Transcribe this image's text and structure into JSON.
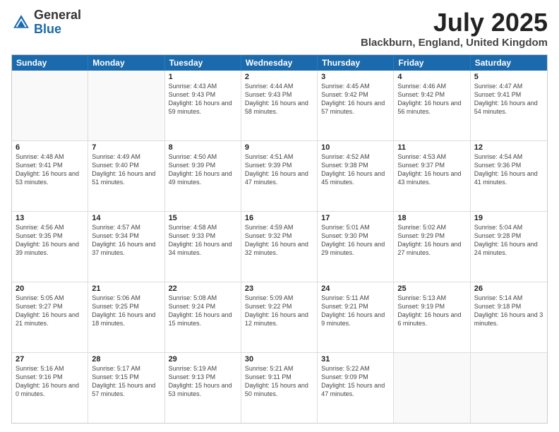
{
  "logo": {
    "general": "General",
    "blue": "Blue"
  },
  "title": {
    "month": "July 2025",
    "location": "Blackburn, England, United Kingdom"
  },
  "days_of_week": [
    "Sunday",
    "Monday",
    "Tuesday",
    "Wednesday",
    "Thursday",
    "Friday",
    "Saturday"
  ],
  "weeks": [
    [
      {
        "day": "",
        "sunrise": "",
        "sunset": "",
        "daylight": ""
      },
      {
        "day": "",
        "sunrise": "",
        "sunset": "",
        "daylight": ""
      },
      {
        "day": "1",
        "sunrise": "Sunrise: 4:43 AM",
        "sunset": "Sunset: 9:43 PM",
        "daylight": "Daylight: 16 hours and 59 minutes."
      },
      {
        "day": "2",
        "sunrise": "Sunrise: 4:44 AM",
        "sunset": "Sunset: 9:43 PM",
        "daylight": "Daylight: 16 hours and 58 minutes."
      },
      {
        "day": "3",
        "sunrise": "Sunrise: 4:45 AM",
        "sunset": "Sunset: 9:42 PM",
        "daylight": "Daylight: 16 hours and 57 minutes."
      },
      {
        "day": "4",
        "sunrise": "Sunrise: 4:46 AM",
        "sunset": "Sunset: 9:42 PM",
        "daylight": "Daylight: 16 hours and 56 minutes."
      },
      {
        "day": "5",
        "sunrise": "Sunrise: 4:47 AM",
        "sunset": "Sunset: 9:41 PM",
        "daylight": "Daylight: 16 hours and 54 minutes."
      }
    ],
    [
      {
        "day": "6",
        "sunrise": "Sunrise: 4:48 AM",
        "sunset": "Sunset: 9:41 PM",
        "daylight": "Daylight: 16 hours and 53 minutes."
      },
      {
        "day": "7",
        "sunrise": "Sunrise: 4:49 AM",
        "sunset": "Sunset: 9:40 PM",
        "daylight": "Daylight: 16 hours and 51 minutes."
      },
      {
        "day": "8",
        "sunrise": "Sunrise: 4:50 AM",
        "sunset": "Sunset: 9:39 PM",
        "daylight": "Daylight: 16 hours and 49 minutes."
      },
      {
        "day": "9",
        "sunrise": "Sunrise: 4:51 AM",
        "sunset": "Sunset: 9:39 PM",
        "daylight": "Daylight: 16 hours and 47 minutes."
      },
      {
        "day": "10",
        "sunrise": "Sunrise: 4:52 AM",
        "sunset": "Sunset: 9:38 PM",
        "daylight": "Daylight: 16 hours and 45 minutes."
      },
      {
        "day": "11",
        "sunrise": "Sunrise: 4:53 AM",
        "sunset": "Sunset: 9:37 PM",
        "daylight": "Daylight: 16 hours and 43 minutes."
      },
      {
        "day": "12",
        "sunrise": "Sunrise: 4:54 AM",
        "sunset": "Sunset: 9:36 PM",
        "daylight": "Daylight: 16 hours and 41 minutes."
      }
    ],
    [
      {
        "day": "13",
        "sunrise": "Sunrise: 4:56 AM",
        "sunset": "Sunset: 9:35 PM",
        "daylight": "Daylight: 16 hours and 39 minutes."
      },
      {
        "day": "14",
        "sunrise": "Sunrise: 4:57 AM",
        "sunset": "Sunset: 9:34 PM",
        "daylight": "Daylight: 16 hours and 37 minutes."
      },
      {
        "day": "15",
        "sunrise": "Sunrise: 4:58 AM",
        "sunset": "Sunset: 9:33 PM",
        "daylight": "Daylight: 16 hours and 34 minutes."
      },
      {
        "day": "16",
        "sunrise": "Sunrise: 4:59 AM",
        "sunset": "Sunset: 9:32 PM",
        "daylight": "Daylight: 16 hours and 32 minutes."
      },
      {
        "day": "17",
        "sunrise": "Sunrise: 5:01 AM",
        "sunset": "Sunset: 9:30 PM",
        "daylight": "Daylight: 16 hours and 29 minutes."
      },
      {
        "day": "18",
        "sunrise": "Sunrise: 5:02 AM",
        "sunset": "Sunset: 9:29 PM",
        "daylight": "Daylight: 16 hours and 27 minutes."
      },
      {
        "day": "19",
        "sunrise": "Sunrise: 5:04 AM",
        "sunset": "Sunset: 9:28 PM",
        "daylight": "Daylight: 16 hours and 24 minutes."
      }
    ],
    [
      {
        "day": "20",
        "sunrise": "Sunrise: 5:05 AM",
        "sunset": "Sunset: 9:27 PM",
        "daylight": "Daylight: 16 hours and 21 minutes."
      },
      {
        "day": "21",
        "sunrise": "Sunrise: 5:06 AM",
        "sunset": "Sunset: 9:25 PM",
        "daylight": "Daylight: 16 hours and 18 minutes."
      },
      {
        "day": "22",
        "sunrise": "Sunrise: 5:08 AM",
        "sunset": "Sunset: 9:24 PM",
        "daylight": "Daylight: 16 hours and 15 minutes."
      },
      {
        "day": "23",
        "sunrise": "Sunrise: 5:09 AM",
        "sunset": "Sunset: 9:22 PM",
        "daylight": "Daylight: 16 hours and 12 minutes."
      },
      {
        "day": "24",
        "sunrise": "Sunrise: 5:11 AM",
        "sunset": "Sunset: 9:21 PM",
        "daylight": "Daylight: 16 hours and 9 minutes."
      },
      {
        "day": "25",
        "sunrise": "Sunrise: 5:13 AM",
        "sunset": "Sunset: 9:19 PM",
        "daylight": "Daylight: 16 hours and 6 minutes."
      },
      {
        "day": "26",
        "sunrise": "Sunrise: 5:14 AM",
        "sunset": "Sunset: 9:18 PM",
        "daylight": "Daylight: 16 hours and 3 minutes."
      }
    ],
    [
      {
        "day": "27",
        "sunrise": "Sunrise: 5:16 AM",
        "sunset": "Sunset: 9:16 PM",
        "daylight": "Daylight: 16 hours and 0 minutes."
      },
      {
        "day": "28",
        "sunrise": "Sunrise: 5:17 AM",
        "sunset": "Sunset: 9:15 PM",
        "daylight": "Daylight: 15 hours and 57 minutes."
      },
      {
        "day": "29",
        "sunrise": "Sunrise: 5:19 AM",
        "sunset": "Sunset: 9:13 PM",
        "daylight": "Daylight: 15 hours and 53 minutes."
      },
      {
        "day": "30",
        "sunrise": "Sunrise: 5:21 AM",
        "sunset": "Sunset: 9:11 PM",
        "daylight": "Daylight: 15 hours and 50 minutes."
      },
      {
        "day": "31",
        "sunrise": "Sunrise: 5:22 AM",
        "sunset": "Sunset: 9:09 PM",
        "daylight": "Daylight: 15 hours and 47 minutes."
      },
      {
        "day": "",
        "sunrise": "",
        "sunset": "",
        "daylight": ""
      },
      {
        "day": "",
        "sunrise": "",
        "sunset": "",
        "daylight": ""
      }
    ]
  ]
}
